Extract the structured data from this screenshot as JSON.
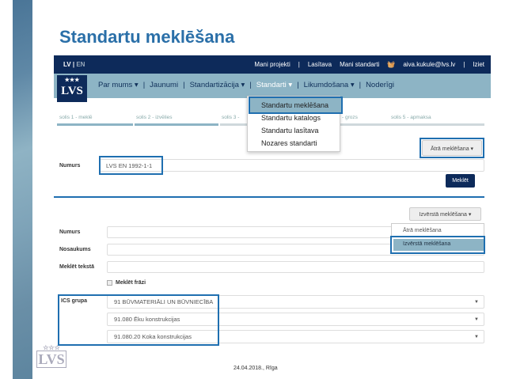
{
  "slide_title": "Standartu meklēšana",
  "topbar": {
    "lang_lv": "LV",
    "lang_en": "EN",
    "links": [
      "Mani projekti",
      "Lasītava",
      "Mani standarti"
    ],
    "cart_icon": "basket-icon",
    "user": "aiva.kukule@lvs.lv",
    "logout": "Iziet"
  },
  "logo": "LVS",
  "nav": {
    "items": [
      "Par mums ▾",
      "Jaunumi",
      "Standartizācija ▾",
      "Standarti ▾",
      "Likumdošana ▾",
      "Noderīgi"
    ],
    "active": "Standarti ▾"
  },
  "steps": [
    "solis 1 - meklē",
    "solis 2 - izvēlies",
    "solis 3 -",
    "- grozs",
    "solis 5 - apmaksa"
  ],
  "menu": [
    "Standartu meklēšana",
    "Standartu katalogs",
    "Standartu lasītava",
    "Nozares standarti"
  ],
  "quick": {
    "toggle": "Ātrā meklēšana ▾",
    "numurs_label": "Numurs",
    "numurs_value": "LVS EN 1992-1-1",
    "search_btn": "Meklēt"
  },
  "advanced": {
    "toggle": "Izvērstā meklēšana ▾",
    "numurs_label": "Numurs",
    "nosaukums_label": "Nosaukums",
    "text_label": "Meklēt tekstā",
    "phrase_label": "Meklēt frāzi",
    "ics_label": "ICS grupa",
    "ics": [
      "91 BŪVMATERIĀLI UN BŪVNIECĪBA",
      "91.080 Ēku konstrukcijas",
      "91.080.20 Koka konstrukcijas"
    ],
    "dropdown": [
      "Ātrā meklēšana",
      "Izvērstā meklēšana"
    ]
  },
  "footer": {
    "date": "24.04.2018., Rīga",
    "logo": "LVS"
  }
}
